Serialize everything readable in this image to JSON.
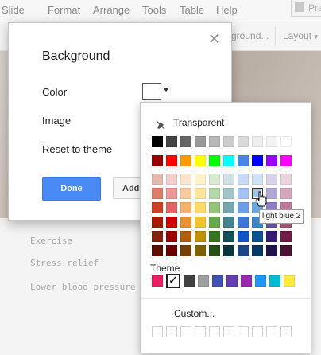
{
  "menubar": {
    "items": [
      "Slide",
      "Format",
      "Arrange",
      "Tools",
      "Table",
      "Help"
    ],
    "present_label": "Pre"
  },
  "toolbar": {
    "background_btn_label": "ground...",
    "layout_label": "Layout",
    "layout_icon": "chevron-down-icon"
  },
  "slide": {
    "list_items": [
      "Exercise",
      "Stress relief",
      "Lower blood pressure"
    ]
  },
  "dialog": {
    "title": "Background",
    "close_icon": "close-icon",
    "color_label": "Color",
    "image_label": "Image",
    "reset_label": "Reset to theme",
    "done_label": "Done",
    "add_label": "Add",
    "current_color": "#ffffff"
  },
  "palette": {
    "transparent_label": "Transparent",
    "transparent_icon": "paint-bucket-slash-icon",
    "grays": [
      "#000000",
      "#434343",
      "#666666",
      "#999999",
      "#b7b7b7",
      "#cccccc",
      "#d9d9d9",
      "#efefef",
      "#f3f3f3",
      "#ffffff"
    ],
    "brights": [
      "#980000",
      "#ff0000",
      "#ff9900",
      "#ffff00",
      "#00ff00",
      "#00ffff",
      "#4a86e8",
      "#0000ff",
      "#9900ff",
      "#ff00ff"
    ],
    "shades": [
      [
        "#e6b8af",
        "#f4cccc",
        "#fce5cd",
        "#fff2cc",
        "#d9ead3",
        "#d0e0e3",
        "#c9daf8",
        "#cfe2f3",
        "#d9d2e9",
        "#ead1dc"
      ],
      [
        "#dd7e6b",
        "#ea9999",
        "#f9cb9c",
        "#ffe599",
        "#b6d7a8",
        "#a2c4c9",
        "#a4c2f4",
        "#9fc5e8",
        "#b4a7d6",
        "#d5a6bd"
      ],
      [
        "#cc4125",
        "#e06666",
        "#f6b26b",
        "#ffd966",
        "#93c47d",
        "#76a5af",
        "#6d9eeb",
        "#6fa8dc",
        "#8e7cc3",
        "#c27ba0"
      ],
      [
        "#a61c00",
        "#cc0000",
        "#e69138",
        "#f1c232",
        "#6aa84f",
        "#45818e",
        "#3c78d8",
        "#3d85c6",
        "#674ea7",
        "#a64d79"
      ],
      [
        "#85200c",
        "#990000",
        "#b45f06",
        "#bf9000",
        "#38761d",
        "#134f5c",
        "#1155cc",
        "#0b5394",
        "#351c75",
        "#741b47"
      ],
      [
        "#5b0f00",
        "#660000",
        "#783f04",
        "#7f6000",
        "#274e13",
        "#0c343d",
        "#1c4587",
        "#073763",
        "#20124d",
        "#4c1130"
      ]
    ],
    "theme_label": "Theme",
    "theme_colors": [
      "#e91e63",
      "#ffffff",
      "#424242",
      "#9e9e9e",
      "#3f51b5",
      "#673ab7",
      "#9c27b0",
      "#2196f3",
      "#00bcd4",
      "#ffeb3b"
    ],
    "custom_label": "Custom...",
    "custom_slots": 10,
    "tooltip": "light blue 2"
  }
}
